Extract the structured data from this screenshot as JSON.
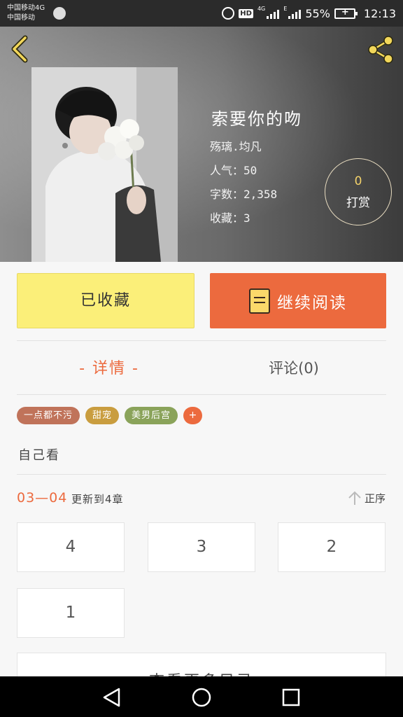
{
  "status_bar": {
    "carrier_1": "中国移动4G",
    "carrier_2": "中国移动",
    "hd_label": "HD",
    "net_1": "4G",
    "net_2": "E",
    "battery": "55%",
    "time": "12:13"
  },
  "book": {
    "title": "索要你的吻",
    "author": "殇璃.均凡",
    "popularity": "人气：50",
    "word_count": "字数：2,358",
    "favorites": "收藏：3"
  },
  "reward": {
    "count": "0",
    "label": "打赏"
  },
  "actions": {
    "favorited_label": "已收藏",
    "continue_label": "继续阅读"
  },
  "tabs": {
    "detail": "- 详情 -",
    "comments": "评论(0)"
  },
  "tags": [
    {
      "label": "一点都不污",
      "color": "#c0735a"
    },
    {
      "label": "甜宠",
      "color": "#c99d3f"
    },
    {
      "label": "美男后宫",
      "color": "#8aa35a"
    }
  ],
  "tag_add_label": "+",
  "description": "自己看",
  "update": {
    "date": "03—04",
    "text": "更新到4章"
  },
  "sort_label": "正序",
  "chapters": [
    "4",
    "3",
    "2",
    "1"
  ],
  "more_label": "查看更多目录",
  "colors": {
    "accent": "#ec6a3e",
    "favorite": "#fbef79",
    "reward_count": "#f4d36b"
  },
  "icons": {
    "back": "chevron-left-icon",
    "share": "share-icon",
    "book": "book-icon",
    "sort": "arrow-up-icon",
    "nav_back": "triangle-back-icon",
    "nav_home": "circle-home-icon",
    "nav_recent": "square-recent-icon"
  }
}
